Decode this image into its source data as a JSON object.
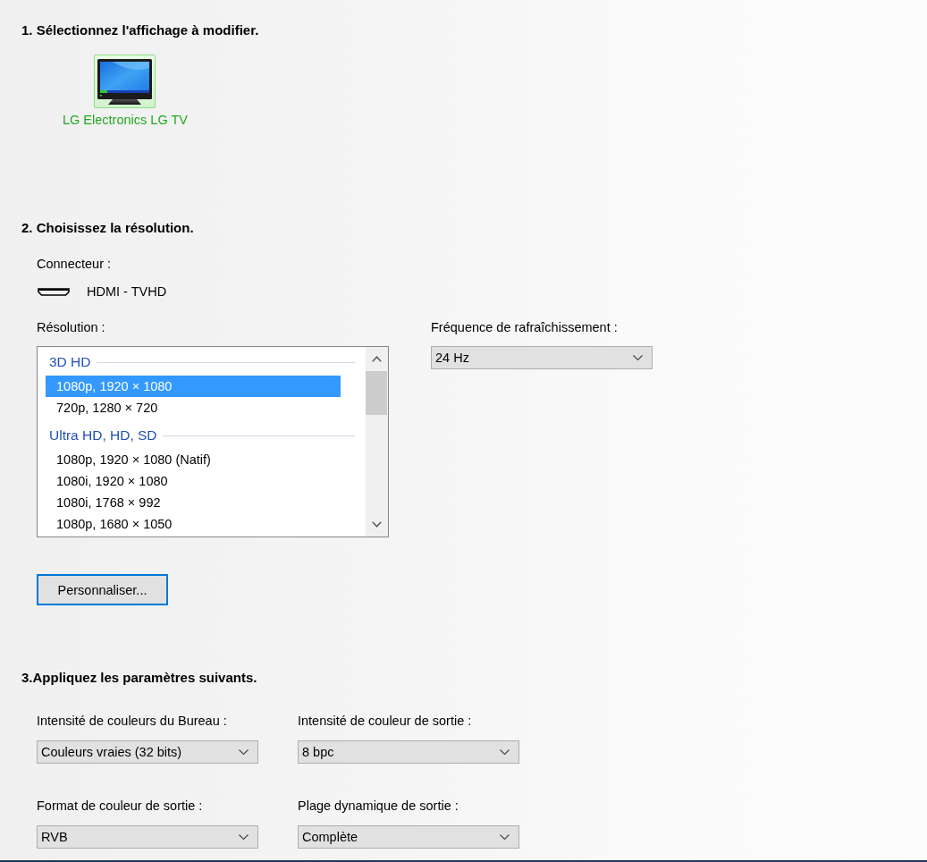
{
  "display_section": {
    "heading": "1. Sélectionnez l'affichage à modifier.",
    "displays": [
      {
        "name": "LG Electronics LG TV",
        "selected": true
      }
    ]
  },
  "resolution_section": {
    "heading": "2. Choisissez la résolution.",
    "connector_label": "Connecteur :",
    "connector": "HDMI - TVHD",
    "resolution_label": "Résolution :",
    "resolution_list": {
      "groups": [
        {
          "title": "3D HD",
          "items": [
            {
              "label": "1080p, 1920 × 1080",
              "selected": true
            },
            {
              "label": "720p, 1280 × 720",
              "selected": false
            }
          ]
        },
        {
          "title": "Ultra HD, HD, SD",
          "items": [
            {
              "label": "1080p, 1920 × 1080 (Natif)",
              "selected": false
            },
            {
              "label": "1080i, 1920 × 1080",
              "selected": false
            },
            {
              "label": "1080i, 1768 × 992",
              "selected": false
            },
            {
              "label": "1080p, 1680 × 1050",
              "selected": false
            }
          ]
        }
      ]
    },
    "refresh_label": "Fréquence de rafraîchissement :",
    "refresh_rate": {
      "value": "24 Hz"
    },
    "customize_button": "Personnaliser..."
  },
  "settings_section": {
    "heading": "3.Appliquez les paramètres suivants.",
    "fields": [
      {
        "label": "Intensité de couleurs du Bureau :",
        "value": "Couleurs vraies (32 bits)"
      },
      {
        "label": "Intensité de couleur de sortie :",
        "value": "8 bpc"
      },
      {
        "label": "Format de couleur de sortie :",
        "value": "RVB"
      },
      {
        "label": "Plage dynamique de sortie :",
        "value": "Complète"
      }
    ]
  }
}
